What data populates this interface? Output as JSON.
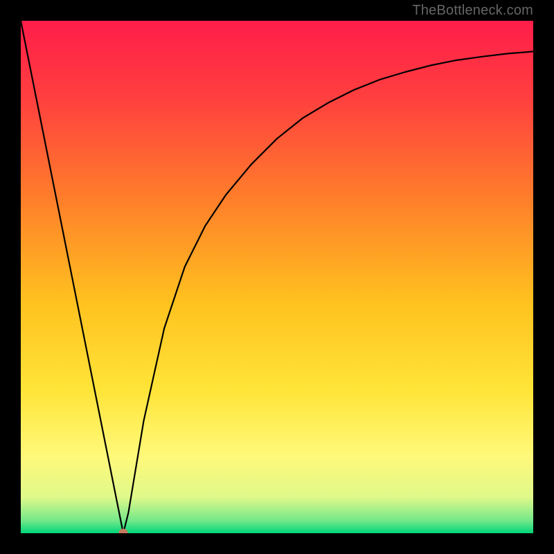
{
  "watermark": "TheBottleneck.com",
  "chart_data": {
    "type": "line",
    "title": "",
    "xlabel": "",
    "ylabel": "",
    "xlim": [
      0,
      100
    ],
    "ylim": [
      0,
      100
    ],
    "grid": false,
    "legend": false,
    "gradient_stops": [
      {
        "pos": 0.0,
        "color": "#ff1d49"
      },
      {
        "pos": 0.15,
        "color": "#ff3f3f"
      },
      {
        "pos": 0.35,
        "color": "#ff7f2a"
      },
      {
        "pos": 0.55,
        "color": "#ffc21f"
      },
      {
        "pos": 0.72,
        "color": "#ffe438"
      },
      {
        "pos": 0.85,
        "color": "#fff97a"
      },
      {
        "pos": 0.93,
        "color": "#dff98a"
      },
      {
        "pos": 0.975,
        "color": "#75e88a"
      },
      {
        "pos": 1.0,
        "color": "#00d679"
      }
    ],
    "series": [
      {
        "name": "bottleneck-curve",
        "x": [
          0,
          4,
          8,
          12,
          16,
          19,
          20,
          21,
          22,
          24,
          28,
          32,
          36,
          40,
          45,
          50,
          55,
          60,
          65,
          70,
          75,
          80,
          85,
          90,
          95,
          100
        ],
        "y": [
          100,
          80,
          60,
          40,
          20,
          5,
          0,
          4,
          10,
          22,
          40,
          52,
          60,
          66,
          72,
          77,
          81,
          84,
          86.5,
          88.5,
          90,
          91.3,
          92.3,
          93,
          93.6,
          94
        ]
      }
    ],
    "marker": {
      "x": 20,
      "y": 0,
      "color": "#c57a60",
      "radius_pct": 0.9
    }
  }
}
